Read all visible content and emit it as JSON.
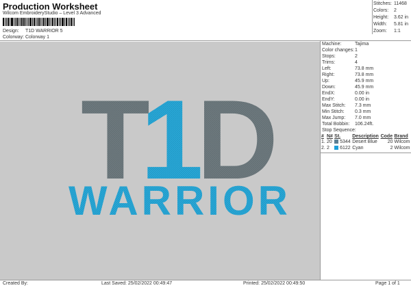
{
  "header": {
    "title": "Production Worksheet",
    "subtitle": "Wilcom EmbroideryStudio – Level 3 Advanced",
    "design_label": "Design:",
    "design_value": "T1D WARRIOR 5",
    "colorway_label": "Colorway:",
    "colorway_value": "Colorway 1"
  },
  "stats": [
    {
      "label": "Stitches:",
      "value": "11468"
    },
    {
      "label": "Colors:",
      "value": "2"
    },
    {
      "label": "Height:",
      "value": "3.62 in"
    },
    {
      "label": "Width:",
      "value": "5.81 in"
    },
    {
      "label": "Zoom:",
      "value": "1:1"
    }
  ],
  "design_preview": {
    "line1_a": "T",
    "line1_b": "1",
    "line1_c": "D",
    "line2": "WARRIOR",
    "gray_color": "#6e7a7f",
    "cyan_color": "#2aa9d8"
  },
  "machine_info": [
    {
      "label": "Machine:",
      "value": "Tajima"
    },
    {
      "label": "Color changes:",
      "value": "1"
    },
    {
      "label": "Stops:",
      "value": "2"
    },
    {
      "label": "Trims:",
      "value": "4"
    },
    {
      "label": "Left:",
      "value": "73.8 mm"
    },
    {
      "label": "Right:",
      "value": "73.8 mm"
    },
    {
      "label": "Up:",
      "value": "45.9 mm"
    },
    {
      "label": "Down:",
      "value": "45.9 mm"
    },
    {
      "label": "EndX:",
      "value": "0.00 in"
    },
    {
      "label": "EndY:",
      "value": "0.00 in"
    },
    {
      "label": "Max Stitch:",
      "value": "7.3 mm"
    },
    {
      "label": "Min Stitch:",
      "value": "0.3 mm"
    },
    {
      "label": "Max Jump:",
      "value": "7.0 mm"
    },
    {
      "label": "Total Bobbin:",
      "value": "106.24ft."
    }
  ],
  "stop_sequence": {
    "title": "Stop Sequence:",
    "headers": [
      "#",
      "N#",
      "St.",
      "Description",
      "Code",
      "Brand"
    ],
    "rows": [
      {
        "idx": "1.",
        "n": "20",
        "swatch": "#5b7f93",
        "st": "5344",
        "description": "Desert Blue",
        "code": "20",
        "brand": "Wilcom"
      },
      {
        "idx": "2.",
        "n": "2",
        "swatch": "#1d9fd9",
        "st": "6122",
        "description": "Cyan",
        "code": "2",
        "brand": "Wilcom"
      }
    ]
  },
  "footer": {
    "created_by": "Created By:",
    "last_saved": "Last Saved: 25/02/2022 00:49:47",
    "printed": "Printed: 25/02/2022 00:49:50",
    "page": "Page 1 of 1"
  }
}
